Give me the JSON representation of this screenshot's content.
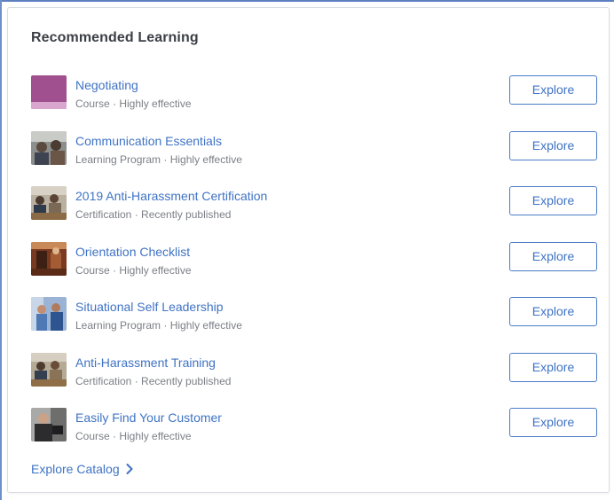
{
  "card": {
    "title": "Recommended Learning",
    "footer_link": "Explore Catalog",
    "footer_icon": "chevron-right-icon"
  },
  "items": [
    {
      "title": "Negotiating",
      "meta": "Course · Highly effective",
      "button": "Explore",
      "thumb": "negotiating-thumbnail"
    },
    {
      "title": "Communication Essentials",
      "meta": "Learning Program · Highly effective",
      "button": "Explore",
      "thumb": "communication-thumbnail"
    },
    {
      "title": "2019 Anti-Harassment Certification",
      "meta": "Certification · Recently published",
      "button": "Explore",
      "thumb": "anti-harassment-cert-thumbnail"
    },
    {
      "title": "Orientation Checklist",
      "meta": "Course · Highly effective",
      "button": "Explore",
      "thumb": "orientation-thumbnail"
    },
    {
      "title": "Situational Self Leadership",
      "meta": "Learning Program · Highly effective",
      "button": "Explore",
      "thumb": "self-leadership-thumbnail"
    },
    {
      "title": "Anti-Harassment Training",
      "meta": "Certification · Recently published",
      "button": "Explore",
      "thumb": "anti-harassment-training-thumbnail"
    },
    {
      "title": "Easily Find Your Customer",
      "meta": "Course · Highly effective",
      "button": "Explore",
      "thumb": "find-customer-thumbnail"
    }
  ],
  "colors": {
    "link": "#3f73c5",
    "title_text": "#3b3f45",
    "meta_text": "#7b7f86",
    "button_border": "#4a7cc8"
  }
}
